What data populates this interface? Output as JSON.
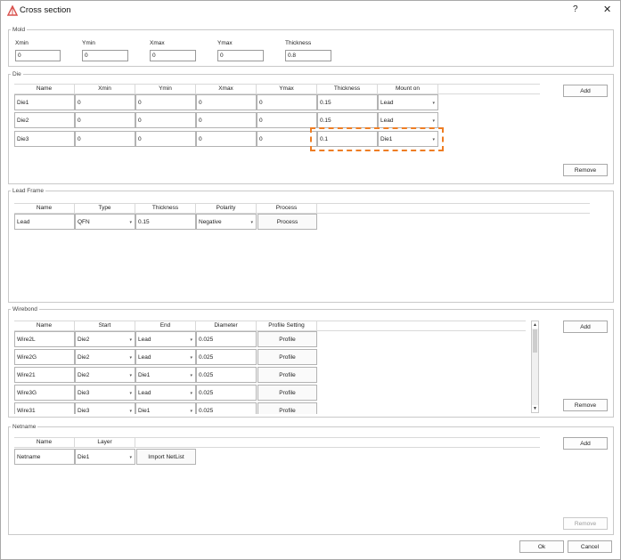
{
  "window": {
    "title": "Cross section",
    "help": "?",
    "close": "✕"
  },
  "mold": {
    "legend": "Mold",
    "fields": [
      {
        "label": "Xmin",
        "value": "0"
      },
      {
        "label": "Ymin",
        "value": "0"
      },
      {
        "label": "Xmax",
        "value": "0"
      },
      {
        "label": "Ymax",
        "value": "0"
      },
      {
        "label": "Thickness",
        "value": "0.8"
      }
    ]
  },
  "die": {
    "legend": "Die",
    "headers": [
      "Name",
      "Xmin",
      "Ymin",
      "Xmax",
      "Ymax",
      "Thickness",
      "Mount on"
    ],
    "rows": [
      {
        "name": "Die1",
        "xmin": "0",
        "ymin": "0",
        "xmax": "0",
        "ymax": "0",
        "thickness": "0.15",
        "mount": "Lead"
      },
      {
        "name": "Die2",
        "xmin": "0",
        "ymin": "0",
        "xmax": "0",
        "ymax": "0",
        "thickness": "0.15",
        "mount": "Lead"
      },
      {
        "name": "Die3",
        "xmin": "0",
        "ymin": "0",
        "xmax": "0",
        "ymax": "0",
        "thickness": "0.1",
        "mount": "Die1"
      }
    ],
    "add": "Add",
    "remove": "Remove"
  },
  "lead_frame": {
    "legend": "Lead Frame",
    "headers": [
      "Name",
      "Type",
      "Thickness",
      "Polarity",
      "Process"
    ],
    "row": {
      "name": "Lead",
      "type": "QFN",
      "thickness": "0.15",
      "polarity": "Negative",
      "process": "Process"
    }
  },
  "wirebond": {
    "legend": "Wirebond",
    "headers": [
      "Name",
      "Start",
      "End",
      "Diameter",
      "Profile Setting"
    ],
    "rows": [
      {
        "name": "Wire2L",
        "start": "Die2",
        "end": "Lead",
        "diameter": "0.025",
        "profile": "Profile"
      },
      {
        "name": "Wire2G",
        "start": "Die2",
        "end": "Lead",
        "diameter": "0.025",
        "profile": "Profile"
      },
      {
        "name": "Wire21",
        "start": "Die2",
        "end": "Die1",
        "diameter": "0.025",
        "profile": "Profile"
      },
      {
        "name": "Wire3G",
        "start": "Die3",
        "end": "Lead",
        "diameter": "0.025",
        "profile": "Profile"
      },
      {
        "name": "Wire31",
        "start": "Die3",
        "end": "Die1",
        "diameter": "0.025",
        "profile": "Profile"
      }
    ],
    "add": "Add",
    "remove": "Remove"
  },
  "netname": {
    "legend": "Netname",
    "headers": [
      "Name",
      "Layer"
    ],
    "row": {
      "name": "Netname",
      "layer": "Die1",
      "import": "Import NetList"
    },
    "add": "Add",
    "remove": "Remove"
  },
  "footer": {
    "ok": "Ok",
    "cancel": "Cancel"
  },
  "colors": {
    "highlight": "#ee7d23",
    "title_icon": "#d9534f"
  }
}
